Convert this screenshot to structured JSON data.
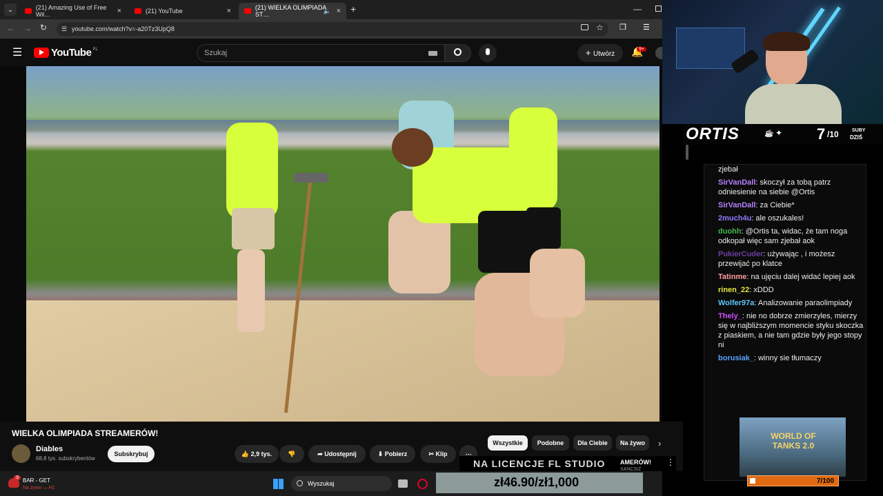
{
  "tabs": [
    {
      "label": "(21) Amazing Use of Free Wil…"
    },
    {
      "label": "(21) YouTube"
    },
    {
      "label": "(21) WIELKA OLIMPIADA ST…"
    }
  ],
  "address": {
    "url": "youtube.com/watch?v=-a20Tz3UpQ8"
  },
  "youtube": {
    "logo": "YouTube",
    "region": "PL",
    "search_placeholder": "Szukaj",
    "create_label": "Utwórz",
    "notif_badge": "9+"
  },
  "video": {
    "title": "WIELKA OLIMPIADA STREAMERÓW!",
    "channel": "Diables",
    "subscribers": "68,8 tys. subskrybentów",
    "subscribe_label": "Subskrybuj",
    "likes": "2,9 tys.",
    "share_label": "Udostępnij",
    "download_label": "Pobierz",
    "clip_label": "Klip"
  },
  "chips": [
    "Wszystkie",
    "Podobne",
    "Dla Ciebie",
    "Na żywo"
  ],
  "taskbar": {
    "live_title": "BAR - GET",
    "live_sub": "Na żywo — H1",
    "badge": "3",
    "search": "Wyszukaj"
  },
  "overlay": {
    "streamer_name": "ORTIS",
    "subs_count": "7",
    "subs_total": "/10",
    "subs_label1": "SUBY",
    "subs_label2": "DZIŚ",
    "license_text": "NA LICENCJE FL STUDIO",
    "side_text1": "AMERÓW!",
    "side_text2": "XANCSIZ",
    "money": "zł46.90/zł1,000",
    "ad_title": "WORLD OF TANKS 2.0",
    "ad_progress": "7/100"
  },
  "chat": [
    {
      "user": "",
      "text": "zjebał",
      "color": "#eeeeee"
    },
    {
      "user": "SirVanDall",
      "text": "skoczył za tobą patrz odniesienie na siebie @Ortis",
      "color": "#b780ff"
    },
    {
      "user": "SirVanDall",
      "text": "za Ciebie*",
      "color": "#b780ff"
    },
    {
      "user": "2much4u",
      "text": "ale oszukales!",
      "color": "#8f7bff"
    },
    {
      "user": "duohh",
      "text": "@Ortis ta, widac, że tam noga odkopał więc sam zjebał aok",
      "color": "#3fb950"
    },
    {
      "user": "PukierCuder",
      "text": "używając , i możesz przewijać po klatce",
      "color": "#6b3fa0"
    },
    {
      "user": "Tatinme",
      "text": "na ujęciu dalej widać lepiej aok",
      "color": "#ff9b9b"
    },
    {
      "user": "rinen_22",
      "text": "xDDD",
      "color": "#e6e63c"
    },
    {
      "user": "Wolfer97a",
      "text": "Analizowanie paraolimpiady",
      "color": "#5ac8fa"
    },
    {
      "user": "Thely_",
      "text": "nie no dobrze zmierzyles, mierzy się w najbliższym momencie styku skoczka z piaskiem, a nie tam gdzie były jego stopy ni",
      "color": "#d14cff"
    },
    {
      "user": "borusiak_",
      "text": "winny sie tłumaczy",
      "color": "#5aa0ff"
    }
  ]
}
